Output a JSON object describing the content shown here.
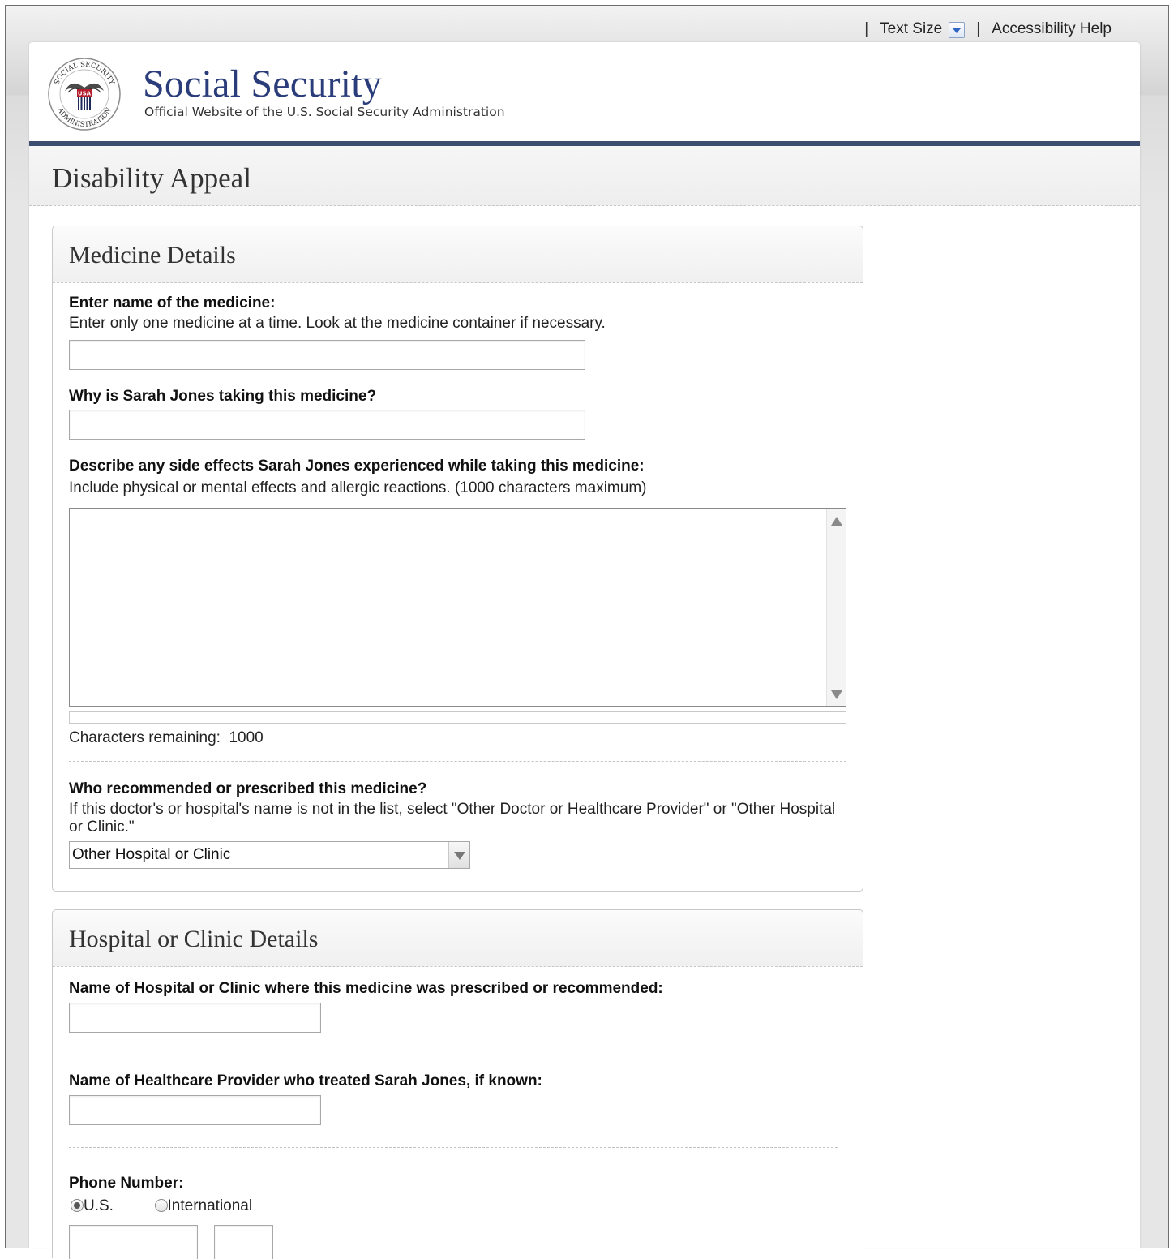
{
  "utility": {
    "separator": "|",
    "text_size": "Text Size",
    "accessibility_help": "Accessibility Help"
  },
  "brand": {
    "title": "Social Security",
    "subtitle": "Official Website of the U.S. Social Security Administration",
    "seal": {
      "ring_text": "SOCIAL SECURITY ADMINISTRATION",
      "center_text": "USA"
    }
  },
  "page_title": "Disability Appeal",
  "medicine_details": {
    "heading": "Medicine Details",
    "medicine_name": {
      "label": "Enter name of the medicine:",
      "help": "Enter only one medicine at a time. Look at the medicine container if necessary.",
      "value": ""
    },
    "reason": {
      "label": "Why is Sarah Jones taking this medicine?",
      "value": ""
    },
    "side_effects": {
      "label": "Describe any side effects Sarah Jones experienced while taking this medicine:",
      "help": "Include physical or mental effects and allergic reactions. (1000 characters maximum)",
      "value": "",
      "characters_remaining_label": "Characters remaining:",
      "characters_remaining": "1000"
    },
    "prescriber": {
      "label": "Who recommended or prescribed this medicine?",
      "help": "If this doctor's or hospital's name is not in the list, select \"Other Doctor or Healthcare Provider\" or \"Other Hospital or Clinic.\"",
      "selected": "Other Hospital or Clinic"
    }
  },
  "hospital_details": {
    "heading": "Hospital or Clinic Details",
    "hospital_name": {
      "label": "Name of Hospital or Clinic where this medicine was prescribed or recommended:",
      "value": ""
    },
    "provider_name": {
      "label": "Name of Healthcare Provider who treated Sarah Jones, if known:",
      "value": ""
    },
    "phone": {
      "label": "Phone Number:",
      "options": [
        "U.S.",
        "International"
      ],
      "selected": "U.S.",
      "number_value": "",
      "extension_value": ""
    }
  }
}
